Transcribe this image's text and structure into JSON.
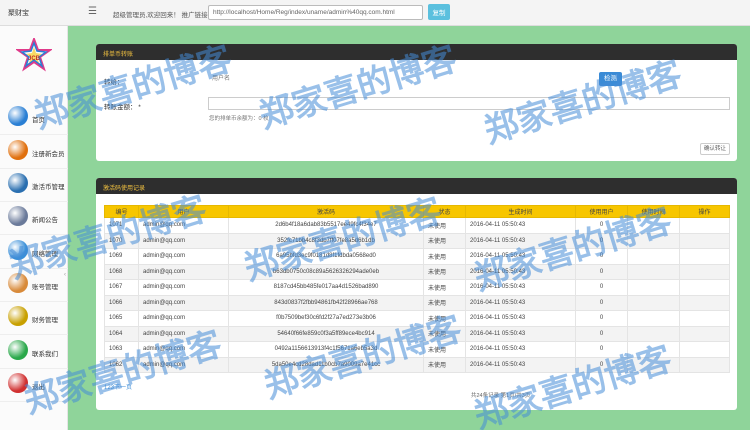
{
  "topbar": {
    "brand": "聚财宝",
    "welcome": "超级管理员,欢迎回来！ 推广链接：",
    "promo_url": "http://localhost/Home/Reg/index/uname/admin%40qq.com.html",
    "copy_label": "复制"
  },
  "sidebar": {
    "logo_text": "JCB",
    "items": [
      {
        "label": "首页",
        "icon": "home-icon",
        "color": "#2a7fd4"
      },
      {
        "label": "注册新会员",
        "icon": "lock-icon",
        "color": "#e0700e"
      },
      {
        "label": "激活币管理",
        "icon": "globe-icon",
        "color": "#2a6fb0"
      },
      {
        "label": "新闻公告",
        "icon": "news-icon",
        "color": "#6a7a9a"
      },
      {
        "label": "网络管理",
        "icon": "network-icon",
        "color": "#3a8fd8"
      },
      {
        "label": "账号管理",
        "icon": "users-icon",
        "color": "#d88a3a"
      },
      {
        "label": "财务管理",
        "icon": "dollar-icon",
        "color": "#c8a000"
      },
      {
        "label": "联系我们",
        "icon": "contact-icon",
        "color": "#2aa84a"
      },
      {
        "label": "退出",
        "icon": "exit-icon",
        "color": "#d03030"
      }
    ]
  },
  "transfer_panel": {
    "title": "排单币转账",
    "to_user_label": "转给：",
    "to_user_placeholder": "用户名",
    "check_label": "检测",
    "amount_label": "转账金额： *",
    "amount_help": "您的排单币余额为：0 枚",
    "confirm_label": "确认转让"
  },
  "codes_panel": {
    "title": "激活码使用记录",
    "columns": [
      "编号",
      "用户",
      "激活码",
      "状态",
      "生成时间",
      "使用用户",
      "使用时间",
      "操作"
    ],
    "rows": [
      [
        "1071",
        "admin@qq.com",
        "2d6b4f18a6dab83b5517ee49fc4f34e7",
        "未使用",
        "2016-04-11 05:50:43",
        "0",
        "",
        ""
      ],
      [
        "1070",
        "admin@qq.com",
        "352fc71bb4c8f3db7ff07fe8a5d6b1db",
        "未使用",
        "2016-04-11 05:50:43",
        "0",
        "",
        ""
      ],
      [
        "1069",
        "admin@qq.com",
        "6a95bfd3ec9f0181d8f1fdbda0568ed0",
        "未使用",
        "2016-04-11 05:50:43",
        "0",
        "",
        ""
      ],
      [
        "1068",
        "admin@qq.com",
        "b63db0750c08c89a5626326294ade0eb",
        "未使用",
        "2016-04-11 05:50:43",
        "0",
        "",
        ""
      ],
      [
        "1067",
        "admin@qq.com",
        "8187cd45bb485fe017aa4d1526bad890",
        "未使用",
        "2016-04-11 05:50:43",
        "0",
        "",
        ""
      ],
      [
        "1066",
        "admin@qq.com",
        "843d0837f2fbb94861fb42f28966ae768",
        "未使用",
        "2016-04-11 05:50:43",
        "0",
        "",
        ""
      ],
      [
        "1065",
        "admin@qq.com",
        "f0b7509bef30c6fd2f27a7ed273e3b06",
        "未使用",
        "2016-04-11 05:50:43",
        "0",
        "",
        ""
      ],
      [
        "1064",
        "admin@qq.com",
        "54640f66fe859c0f3a5ff89ece4bc914",
        "未使用",
        "2016-04-11 05:50:43",
        "0",
        "",
        ""
      ],
      [
        "1063",
        "admin@qq.com",
        "0492a1156613913f4c1f5671a6eb5a3d",
        "未使用",
        "2016-04-11 05:50:43",
        "0",
        "",
        ""
      ],
      [
        "1062",
        "admin@qq.com",
        "5da50e4cd28dad11b0cb7a9009a7e41cc",
        "未使用",
        "2016-04-11 05:50:43",
        "0",
        "",
        ""
      ]
    ],
    "pager_left": "123下一页",
    "pager_center": "共24条记录 第1页/共3页"
  },
  "watermark": "郑家喜的博客",
  "colors": {
    "background": "#8fd49a",
    "panel_header": "#2e2e2e",
    "panel_title": "#f0c040",
    "table_header": "#f7c600",
    "accent": "#3a8bd6"
  }
}
